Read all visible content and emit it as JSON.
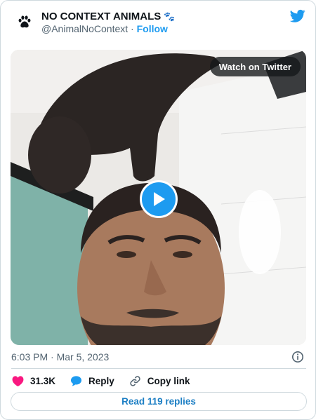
{
  "account": {
    "display_name": "NO CONTEXT ANIMALS",
    "name_emoji": "🐾",
    "handle": "@AnimalNoContext",
    "separator": "·",
    "follow_label": "Follow",
    "avatar_icon": "paw-print-icon"
  },
  "media": {
    "watch_label": "Watch on Twitter",
    "play_icon": "play-icon",
    "description_icon": "video-thumbnail"
  },
  "tweet": {
    "timestamp": "6:03 PM · Mar 5, 2023"
  },
  "actions": {
    "likes": "31.3K",
    "reply_label": "Reply",
    "copy_label": "Copy link"
  },
  "replies": {
    "label": "Read 119 replies"
  },
  "colors": {
    "twitter_blue": "#1d9bf0",
    "like_pink": "#f91880",
    "text_secondary": "#536471",
    "border": "#cfd9de"
  }
}
